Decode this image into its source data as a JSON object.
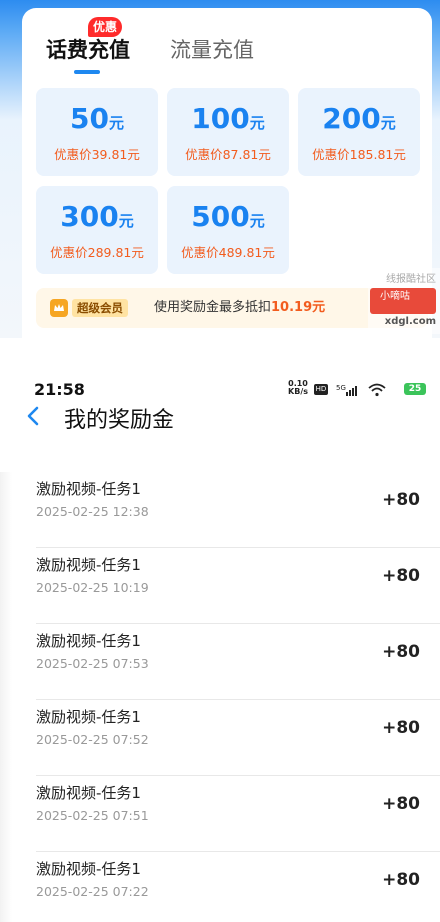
{
  "recharge": {
    "tabs": [
      {
        "label": "话费充值",
        "badge": "优惠"
      },
      {
        "label": "流量充值"
      }
    ],
    "amounts": [
      {
        "value": "50",
        "unit": "元",
        "price": "优惠价39.81元"
      },
      {
        "value": "100",
        "unit": "元",
        "price": "优惠价87.81元"
      },
      {
        "value": "200",
        "unit": "元",
        "price": "优惠价185.81元"
      },
      {
        "value": "300",
        "unit": "元",
        "price": "优惠价289.81元"
      },
      {
        "value": "500",
        "unit": "元",
        "price": "优惠价489.81元"
      }
    ],
    "member": {
      "tag": "超级会员",
      "text": "使用奖励金最多抵扣",
      "amount": "10.19元"
    },
    "watermark": {
      "line1": "线报酷社区",
      "logo": "小嘀咕",
      "site": "xdgl.com"
    }
  },
  "status_bar": {
    "time": "21:58",
    "speed_value": "0.10",
    "speed_unit": "KB/s",
    "hd": "HD",
    "network": "5G",
    "battery": "25"
  },
  "nav": {
    "title": "我的奖励金"
  },
  "rewards": [
    {
      "title": "激励视频-任务1",
      "time": "2025-02-25 12:38",
      "points": "+80"
    },
    {
      "title": "激励视频-任务1",
      "time": "2025-02-25 10:19",
      "points": "+80"
    },
    {
      "title": "激励视频-任务1",
      "time": "2025-02-25 07:53",
      "points": "+80"
    },
    {
      "title": "激励视频-任务1",
      "time": "2025-02-25 07:52",
      "points": "+80"
    },
    {
      "title": "激励视频-任务1",
      "time": "2025-02-25 07:51",
      "points": "+80"
    },
    {
      "title": "激励视频-任务1",
      "time": "2025-02-25 07:22",
      "points": "+80"
    }
  ]
}
